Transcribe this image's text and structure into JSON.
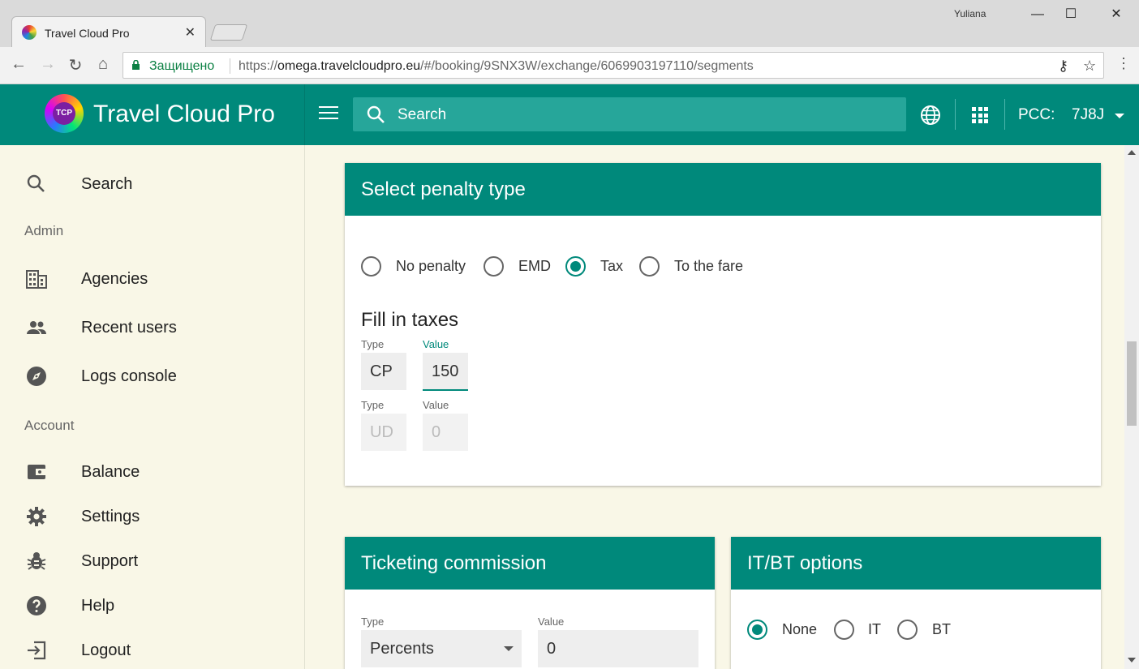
{
  "browser": {
    "tab_title": "Travel Cloud Pro",
    "user_name": "Yuliana",
    "secure_label": "Защищено",
    "url_scheme": "https://",
    "url_host": "omega.travelcloudpro.eu",
    "url_path": "/#/booking/9SNX3W/exchange/6069903197110/segments"
  },
  "app": {
    "title": "Travel Cloud Pro",
    "logo_text": "TCP",
    "search_placeholder": "Search",
    "pcc_label": "PCC:",
    "pcc_value": "7J8J"
  },
  "sidebar": {
    "search_label": "Search",
    "admin_section": "Admin",
    "admin_items": [
      {
        "label": "Agencies",
        "icon": "building-icon"
      },
      {
        "label": "Recent users",
        "icon": "people-icon"
      },
      {
        "label": "Logs console",
        "icon": "compass-icon"
      }
    ],
    "account_section": "Account",
    "account_items": [
      {
        "label": "Balance",
        "icon": "wallet-icon"
      },
      {
        "label": "Settings",
        "icon": "gear-icon"
      },
      {
        "label": "Support",
        "icon": "bug-icon"
      },
      {
        "label": "Help",
        "icon": "help-icon"
      },
      {
        "label": "Logout",
        "icon": "logout-icon"
      }
    ]
  },
  "penalty_card": {
    "title": "Select penalty type",
    "options": [
      "No penalty",
      "EMD",
      "Tax",
      "To the fare"
    ],
    "selected": "Tax",
    "taxes_title": "Fill in taxes",
    "rows": [
      {
        "type_label": "Type",
        "type_value": "CP",
        "value_label": "Value",
        "value": "150"
      },
      {
        "type_label": "Type",
        "type_value": "UD",
        "value_label": "Value",
        "value": "0"
      }
    ]
  },
  "commission_card": {
    "title": "Ticketing commission",
    "type_label": "Type",
    "type_value": "Percents",
    "value_label": "Value",
    "value": "0"
  },
  "itbt_card": {
    "title": "IT/BT options",
    "options": [
      "None",
      "IT",
      "BT"
    ],
    "selected": "None"
  },
  "colors": {
    "primary": "#00897b",
    "sidebar_bg": "#f9f7e7",
    "search_bg": "#26a69a"
  }
}
